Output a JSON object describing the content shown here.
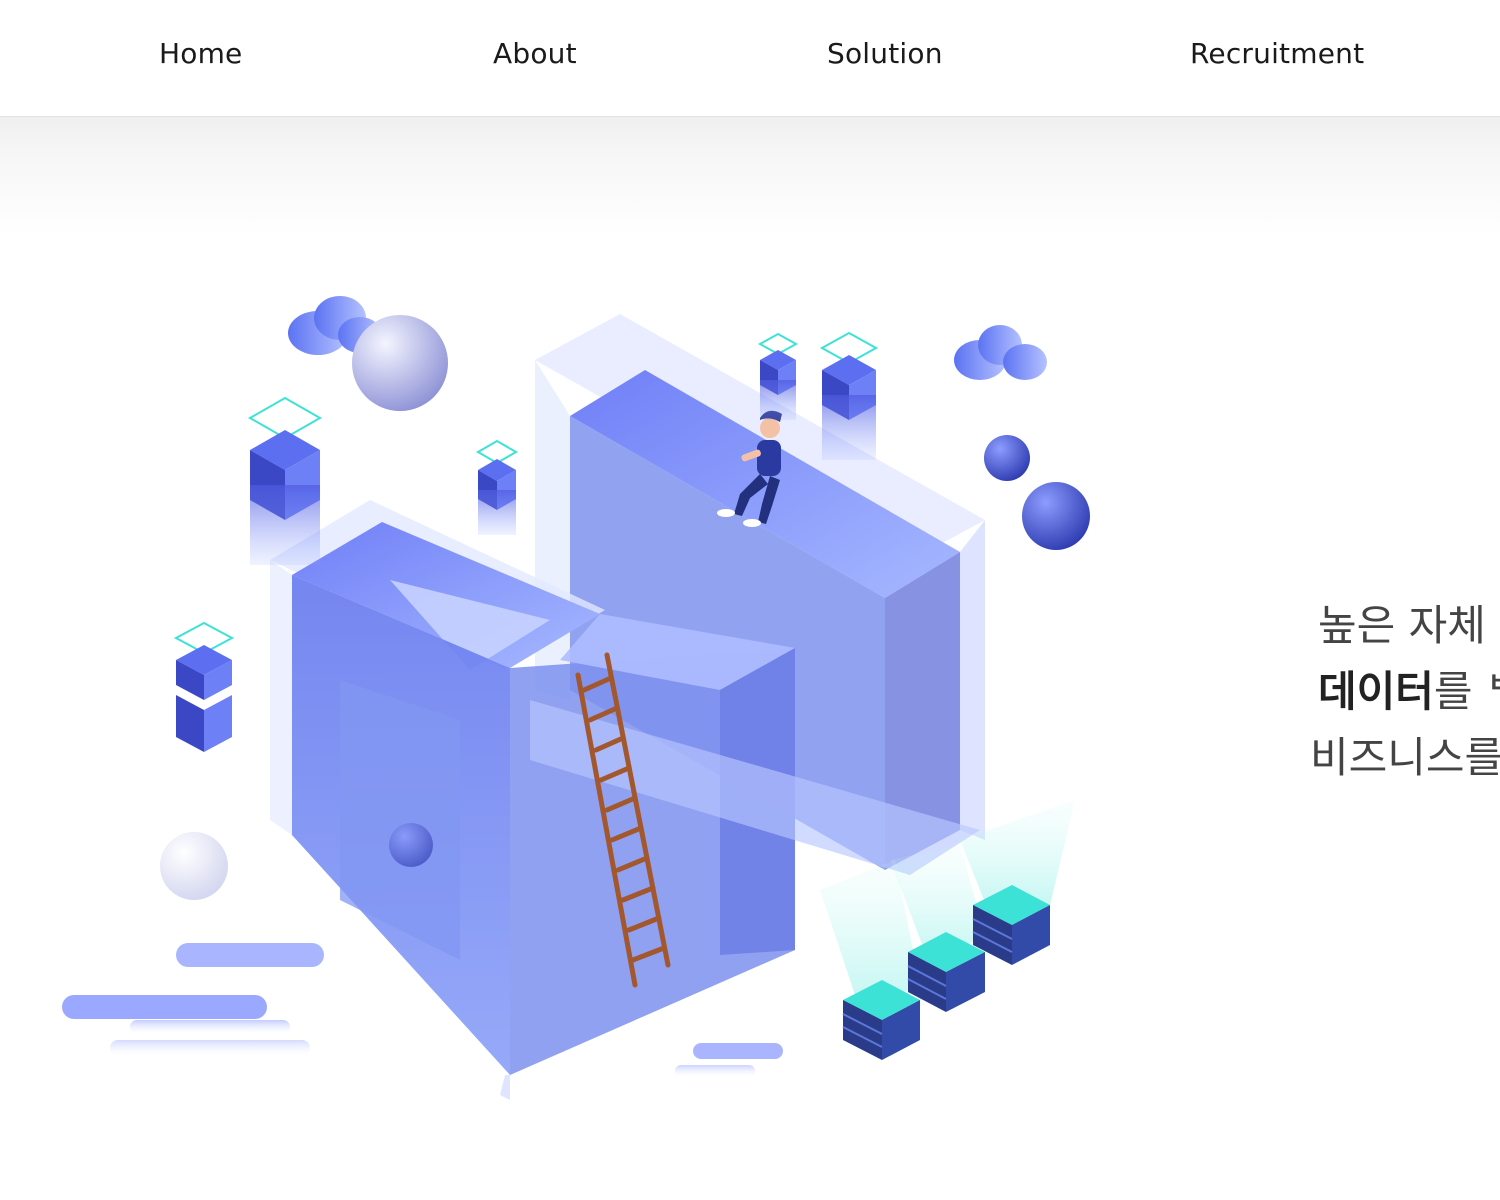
{
  "nav": {
    "items": [
      {
        "label": "Home"
      },
      {
        "label": "About"
      },
      {
        "label": "Solution"
      },
      {
        "label": "Recruitment"
      }
    ]
  },
  "hero": {
    "line1": "높은 자체",
    "line2_strong": "데이터",
    "line2_rest": "를 ᄇ",
    "line3": "비즈니스를"
  },
  "colors": {
    "accent_blue": "#5b6ff0",
    "light_blue": "#a9b6ff",
    "cyan": "#3de2d6",
    "nav_text": "#1a1a1a",
    "body_text": "#3a3a3a"
  },
  "illustration": {
    "subject": "isometric-letter-AI-with-person-ladder-servers-icon"
  }
}
